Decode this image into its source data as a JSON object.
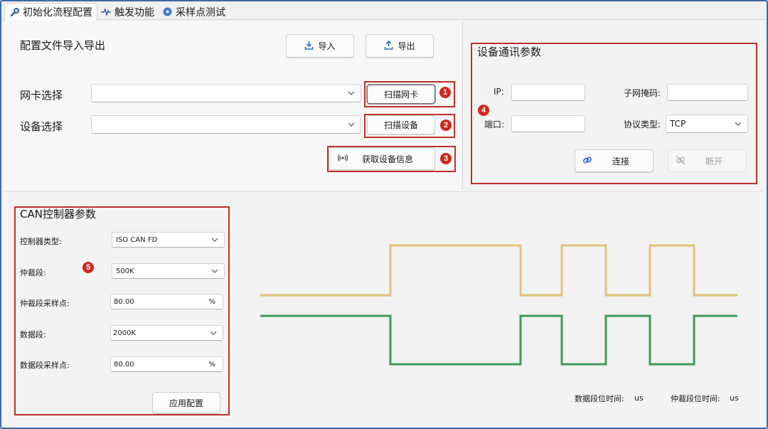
{
  "tabs": [
    {
      "label": "初始化流程配置",
      "icon": "wrench-icon"
    },
    {
      "label": "触发功能",
      "icon": "waveform-icon"
    },
    {
      "label": "采样点测试",
      "icon": "disc-icon"
    }
  ],
  "config": {
    "title": "配置文件导入导出",
    "import_label": "导入",
    "export_label": "导出"
  },
  "nic": {
    "label": "网卡选择",
    "value": "",
    "scan_label": "扫描网卡"
  },
  "device": {
    "label": "设备选择",
    "value": "",
    "scan_label": "扫描设备",
    "info_label": "获取设备信息"
  },
  "comm": {
    "title": "设备通讯参数",
    "ip_label": "IP:",
    "ip_value": "",
    "mask_label": "子网掩码:",
    "mask_value": "",
    "port_label": "端口:",
    "port_value": "",
    "protocol_label": "协议类型:",
    "protocol_value": "TCP",
    "connect_label": "连接",
    "disconnect_label": "断开"
  },
  "can": {
    "title": "CAN控制器参数",
    "controller_type_label": "控制器类型:",
    "controller_type_value": "ISO CAN FD",
    "arb_label": "仲裁段:",
    "arb_value": "500K",
    "arb_sample_label": "仲裁段采样点:",
    "arb_sample_value": "80.00",
    "data_label": "数据段:",
    "data_value": "2000K",
    "data_sample_label": "数据段采样点:",
    "data_sample_value": "80.00",
    "percent": "%",
    "apply_label": "应用配置"
  },
  "timing": {
    "data_bit_time_label": "数据段位时间:",
    "data_bit_time_unit": "us",
    "arb_bit_time_label": "仲裁段位时间:",
    "arb_bit_time_unit": "us"
  },
  "badges": [
    "1",
    "2",
    "3",
    "4",
    "5"
  ],
  "colors": {
    "highlight_box": "#c0302a",
    "badge": "#d0281f",
    "wave_top": "#e2c27a",
    "wave_bottom": "#3f9a55",
    "frame_border": "#3b6aa8"
  }
}
